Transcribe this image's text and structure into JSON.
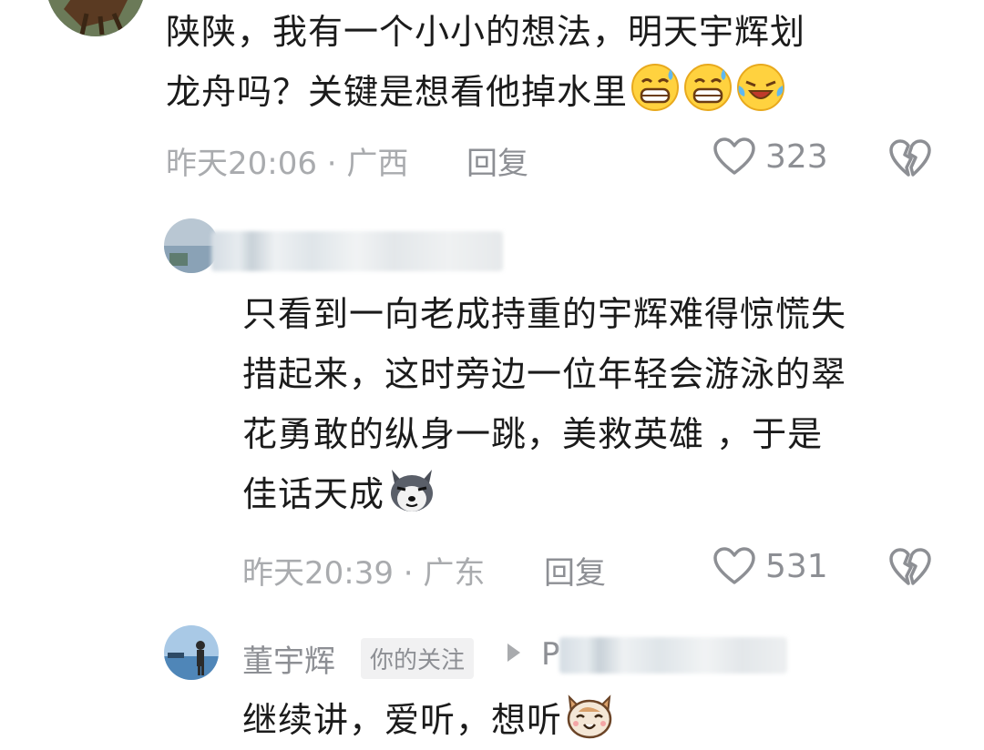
{
  "comments": [
    {
      "text_line1": "陕陕，我有一个小小的想法，明天宇辉划",
      "text_line2": "龙舟吗？关键是想看他掉水里",
      "emojis": [
        "grimace-sweat-emoji",
        "grimace-sweat-emoji",
        "laugh-cry-emoji"
      ],
      "time_location": "昨天20:06 · 广西",
      "reply_label": "回复",
      "likes": "323"
    },
    {
      "username": "",
      "text_lines": [
        "只看到一向老成持重的宇辉难得惊慌失",
        "措起来，这时旁边一位年轻会游泳的翠",
        "花勇敢的纵身一跳，美救英雄 ，于是",
        "佳话天成"
      ],
      "emoji": "husky-dog-emoji",
      "time_location": "昨天20:39 · 广东",
      "reply_label": "回复",
      "likes": "531"
    },
    {
      "username": "董宇辉",
      "tag": "你的关注",
      "reply_to_prefix": "P",
      "text": "继续讲，爱听，想听",
      "emoji": "cat-smile-emoji"
    }
  ],
  "icons": {
    "like": "heart-outline-icon",
    "dislike": "broken-heart-icon",
    "reply_to": "triangle-right-icon"
  },
  "colors": {
    "text": "#1b1b1b",
    "meta": "#a9abae",
    "action": "#8d8f94"
  }
}
